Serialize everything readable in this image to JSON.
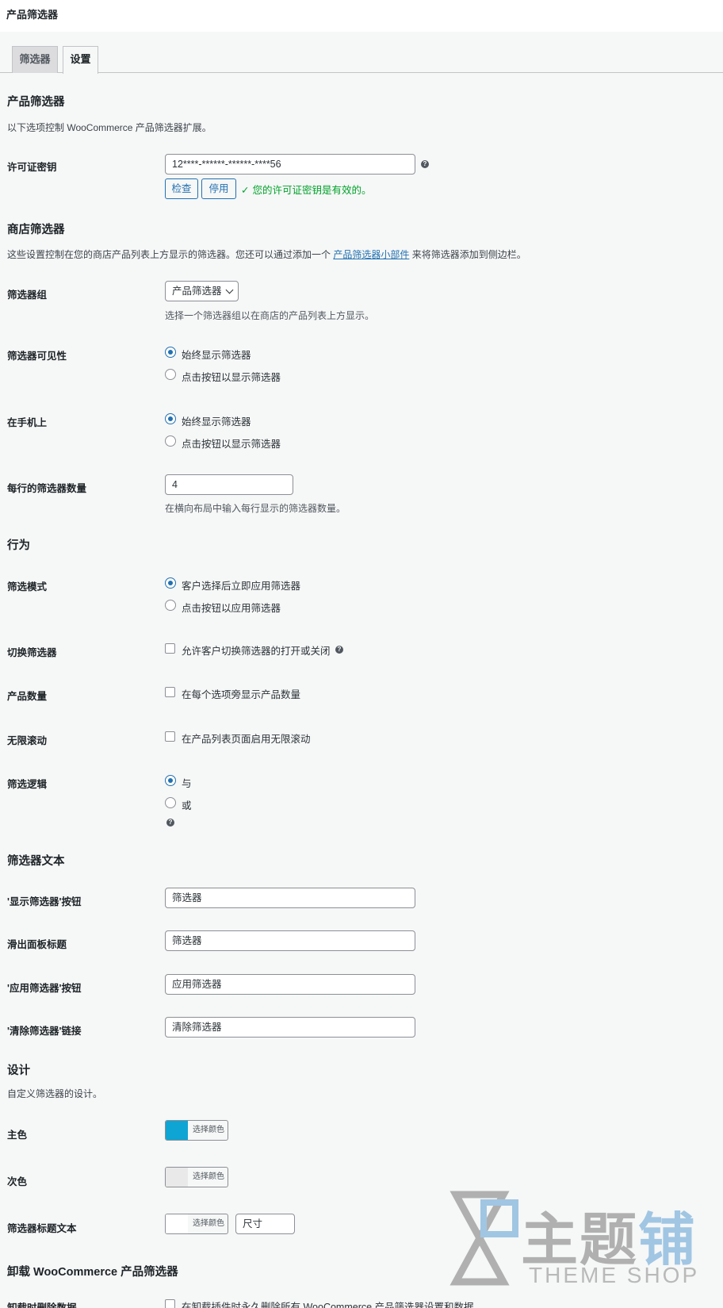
{
  "page": {
    "title": "产品筛选器"
  },
  "tabs": [
    {
      "label": "筛选器"
    },
    {
      "label": "设置"
    }
  ],
  "sections": {
    "product_filter": {
      "heading": "产品筛选器",
      "desc": "以下选项控制 WooCommerce 产品筛选器扩展。"
    },
    "shop_filter": {
      "heading": "商店筛选器",
      "desc_pre": "这些设置控制在您的商店产品列表上方显示的筛选器。您还可以通过添加一个 ",
      "desc_link": "产品筛选器小部件",
      "desc_post": " 来将筛选器添加到侧边栏。"
    },
    "behavior": {
      "heading": "行为"
    },
    "filter_text": {
      "heading": "筛选器文本"
    },
    "design": {
      "heading": "设计",
      "desc": "自定义筛选器的设计。"
    },
    "uninstall": {
      "heading": "卸载 WooCommerce 产品筛选器"
    }
  },
  "license": {
    "label": "许可证密钥",
    "value": "12****-******-******-****56",
    "check_label": "检查",
    "deactivate_label": "停用",
    "valid_msg": "您的许可证密钥是有效的。"
  },
  "filter_group": {
    "label": "筛选器组",
    "value": "产品筛选器",
    "hint": "选择一个筛选器组以在商店的产品列表上方显示。"
  },
  "visibility": {
    "label": "筛选器可见性",
    "options": [
      "始终显示筛选器",
      "点击按钮以显示筛选器"
    ],
    "selected": 0
  },
  "mobile": {
    "label": "在手机上",
    "options": [
      "始终显示筛选器",
      "点击按钮以显示筛选器"
    ],
    "selected": 0
  },
  "per_row": {
    "label": "每行的筛选器数量",
    "value": "4",
    "hint": "在横向布局中输入每行显示的筛选器数量。"
  },
  "filter_mode": {
    "label": "筛选模式",
    "options": [
      "客户选择后立即应用筛选器",
      "点击按钮以应用筛选器"
    ],
    "selected": 0
  },
  "toggle": {
    "label": "切换筛选器",
    "option": "允许客户切换筛选器的打开或关闭"
  },
  "count": {
    "label": "产品数量",
    "option": "在每个选项旁显示产品数量"
  },
  "infinite": {
    "label": "无限滚动",
    "option": "在产品列表页面启用无限滚动"
  },
  "logic": {
    "label": "筛选逻辑",
    "options": [
      "与",
      "或"
    ],
    "selected": 0
  },
  "texts": {
    "show_btn": {
      "label": "'显示筛选器'按钮",
      "value": "筛选器"
    },
    "slide_title": {
      "label": "滑出面板标题",
      "value": "筛选器"
    },
    "apply_btn": {
      "label": "'应用筛选器'按钮",
      "value": "应用筛选器"
    },
    "clear_link": {
      "label": "'清除筛选器'链接",
      "value": "清除筛选器"
    }
  },
  "colors": {
    "primary": {
      "label": "主色",
      "button": "选择颜色",
      "color": "#0ea5d4"
    },
    "secondary": {
      "label": "次色",
      "button": "选择颜色",
      "color": "#e9e9e9"
    },
    "title_text": {
      "label": "筛选器标题文本",
      "button": "选择颜色",
      "color": "#ffffff",
      "size_placeholder": "尺寸"
    }
  },
  "delete_data": {
    "label": "卸载时删除数据",
    "option": "在卸载插件时永久删除所有 WooCommerce 产品筛选器设置和数据"
  },
  "watermark": {
    "cn_a": "主题",
    "cn_b": "铺",
    "en": "THEME SHOP"
  },
  "help_glyph": "?"
}
